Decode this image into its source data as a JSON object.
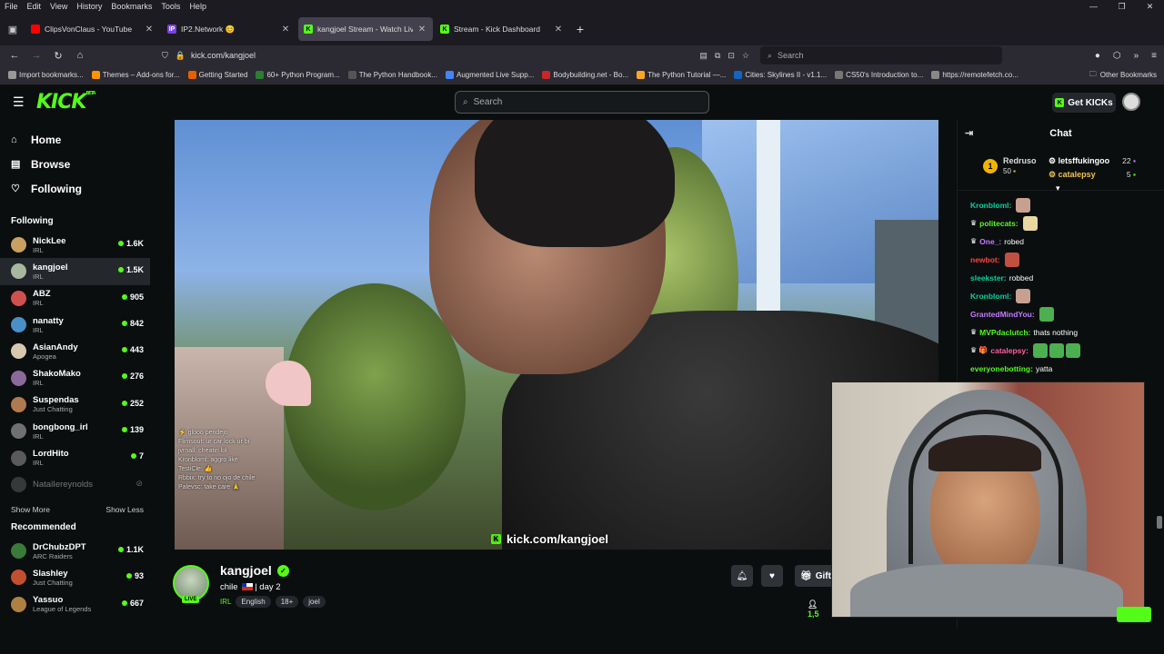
{
  "browser": {
    "menu": [
      "File",
      "Edit",
      "View",
      "History",
      "Bookmarks",
      "Tools",
      "Help"
    ],
    "tabs": [
      {
        "title": "ClipsVonClaus - YouTube",
        "color": "#ff0000",
        "glyph": ""
      },
      {
        "title": "IP2.Network 😊",
        "color": "#7b3fe4",
        "glyph": "IP"
      },
      {
        "title": "kangjoel Stream - Watch Live o",
        "color": "#53fc18",
        "glyph": "K"
      },
      {
        "title": "Stream - Kick Dashboard",
        "color": "#53fc18",
        "glyph": "K"
      }
    ],
    "url": "kick.com/kangjoel",
    "search_placeholder": "Search",
    "bookmarks": [
      {
        "label": "Import bookmarks...",
        "color": "#999"
      },
      {
        "label": "Themes – Add-ons for...",
        "color": "#ff9400"
      },
      {
        "label": "Getting Started",
        "color": "#e66000"
      },
      {
        "label": "60+ Python Program...",
        "color": "#2e7d32"
      },
      {
        "label": "The Python Handbook...",
        "color": "#555"
      },
      {
        "label": "Augmented Live Supp...",
        "color": "#4285f4"
      },
      {
        "label": "Bodybuilding.net - Bo...",
        "color": "#c62828"
      },
      {
        "label": "The Python Tutorial —...",
        "color": "#f9a825"
      },
      {
        "label": "Cities: Skylines II - v1.1...",
        "color": "#1565c0"
      },
      {
        "label": "CS50's Introduction to...",
        "color": "#777"
      },
      {
        "label": "https://remotefetch.co...",
        "color": "#888"
      }
    ],
    "other_bookmarks": "Other Bookmarks"
  },
  "kick": {
    "logo": "KICK",
    "logo_beta": "BETA",
    "search_placeholder": "Search",
    "get_kicks": "Get KICKs",
    "nav": [
      {
        "label": "Home",
        "icon": "⌂"
      },
      {
        "label": "Browse",
        "icon": "▤"
      },
      {
        "label": "Following",
        "icon": "♡"
      }
    ],
    "following_title": "Following",
    "following": [
      {
        "name": "NickLee",
        "cat": "IRL",
        "viewers": "1.6K",
        "color": "#c8a060"
      },
      {
        "name": "kangjoel",
        "cat": "IRL",
        "viewers": "1.5K",
        "color": "#a8b8a0"
      },
      {
        "name": "ABZ",
        "cat": "IRL",
        "viewers": "905",
        "color": "#d05050"
      },
      {
        "name": "nanatty",
        "cat": "IRL",
        "viewers": "842",
        "color": "#4a90c8"
      },
      {
        "name": "AsianAndy",
        "cat": "Apogea",
        "viewers": "443",
        "color": "#d8c8b0"
      },
      {
        "name": "ShakoMako",
        "cat": "IRL",
        "viewers": "276",
        "color": "#8a6a9a"
      },
      {
        "name": "Suspendas",
        "cat": "Just Chatting",
        "viewers": "252",
        "color": "#b07a50"
      },
      {
        "name": "bongbong_irl",
        "cat": "IRL",
        "viewers": "139",
        "color": "#707070"
      },
      {
        "name": "LordHito",
        "cat": "IRL",
        "viewers": "7",
        "color": "#5a5a5a"
      }
    ],
    "offline_channel": "NatalIereynolds",
    "show_more": "Show More",
    "show_less": "Show Less",
    "recommended_title": "Recommended",
    "recommended": [
      {
        "name": "DrChubzDPT",
        "cat": "ARC Raiders",
        "viewers": "1.1K",
        "color": "#3a7a3a"
      },
      {
        "name": "Slashley",
        "cat": "Just Chatting",
        "viewers": "93",
        "color": "#c05030"
      },
      {
        "name": "Yassuo",
        "cat": "League of Legends",
        "viewers": "667",
        "color": "#b08040"
      }
    ],
    "video_tag": "kick.com/kangjoel",
    "video_chat": [
      "⚡ glooo pendejo",
      "Flimsout: ur car lock ur bi",
      "jvrnall: cheatin lol",
      "Kronbloml: aggro like",
      "TestiCle: 👍",
      "Rbbix: try to no ojo de chile",
      "Palevsc: take care 🙏"
    ],
    "streamer": {
      "name": "kangjoel",
      "title_pre": "chile",
      "title_post": "| day 2",
      "category": "IRL",
      "tags": [
        "English",
        "18+",
        "joel"
      ],
      "live": "LIVE",
      "gift_label": "Gift S",
      "viewer_count": "1,5"
    }
  },
  "chat": {
    "title": "Chat",
    "leaderboard": {
      "top": {
        "rank": "1",
        "name": "Redruso",
        "points": "50"
      },
      "list": [
        {
          "name": "letsffukingoo",
          "points": "22"
        },
        {
          "name": "catalepsy",
          "points": "5"
        }
      ]
    },
    "messages": [
      {
        "user": "Kronbloml:",
        "color": "#00d4a0",
        "badge": "",
        "text": "",
        "emotes": [
          "#c8a090"
        ]
      },
      {
        "user": "politecats:",
        "color": "#53fc18",
        "badge": "♛",
        "text": "",
        "emotes": [
          "#e8d8a0"
        ]
      },
      {
        "user": "One_:",
        "color": "#c27dff",
        "badge": "♛",
        "text": "robed",
        "emotes": []
      },
      {
        "user": "newbot:",
        "color": "#ff4444",
        "badge": "",
        "text": "",
        "emotes": [
          "#c05040"
        ]
      },
      {
        "user": "sleekster:",
        "color": "#00d4a0",
        "badge": "",
        "text": "robbed",
        "emotes": []
      },
      {
        "user": "Kronbloml:",
        "color": "#00d4a0",
        "badge": "",
        "text": "",
        "emotes": [
          "#c8a090"
        ]
      },
      {
        "user": "GrantedMindYou:",
        "color": "#c27dff",
        "badge": "",
        "text": "",
        "emotes": [
          "#4caf50"
        ]
      },
      {
        "user": "MVPdaclutch:",
        "color": "#53fc18",
        "badge": "♛",
        "text": "thats nothing",
        "emotes": []
      },
      {
        "user": "catalepsy:",
        "color": "#ff5fa2",
        "badge": "♛ 🎁",
        "text": "",
        "emotes": [
          "#4caf50",
          "#4caf50",
          "#4caf50"
        ]
      },
      {
        "user": "everyonebotting:",
        "color": "#53fc18",
        "badge": "",
        "text": "yatta",
        "emotes": []
      }
    ]
  }
}
